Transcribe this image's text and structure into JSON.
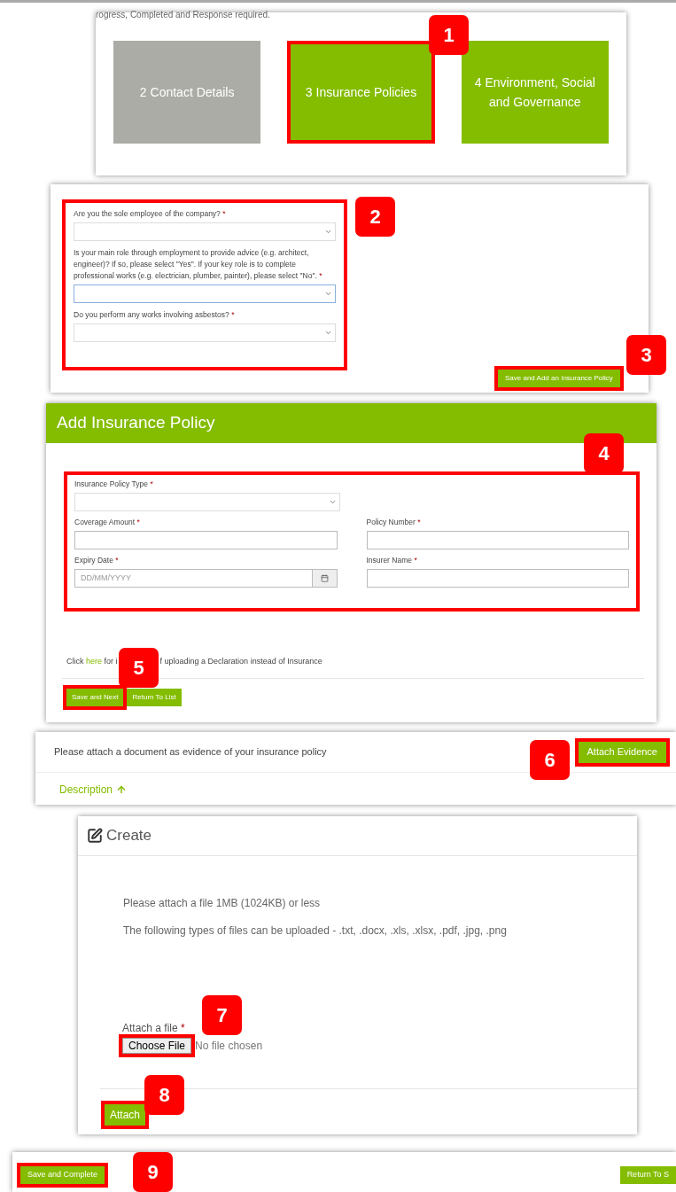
{
  "progress_panel": {
    "note": "rogress, Completed and Response required.",
    "callout": "1",
    "steps": [
      {
        "label": "2 Contact Details",
        "color": "#acaca6",
        "selected": false
      },
      {
        "label": "3 Insurance Policies",
        "color": "#84bc00",
        "selected": true
      },
      {
        "label": "4 Environment, Social and Governance",
        "color": "#84bc00",
        "selected": false
      }
    ]
  },
  "questions_panel": {
    "callout": "2",
    "highlighted": true,
    "questions": [
      {
        "label": "Are you the sole employee of the company?",
        "asterisk": "*",
        "focused": false
      },
      {
        "label": "Is your main role through employment to provide advice (e.g. architect, engineer)? If so, please select \"Yes\". If your key role is to complete professional works (e.g. electrician, plumber, painter), please select \"No\".",
        "asterisk": "*",
        "focused": true
      },
      {
        "label": "Do you perform any works involving asbestos?",
        "asterisk": "*",
        "focused": false
      }
    ],
    "save_button": {
      "label": "Save and Add an Insurance Policy",
      "highlighted": true,
      "callout": "3"
    }
  },
  "policy_form": {
    "title": "Add Insurance Policy",
    "callout": "4",
    "highlighted": true,
    "fields": [
      {
        "kind": "select",
        "label": "Insurance Policy Type",
        "asterisk": "*"
      },
      {
        "kind": "text",
        "label": "Coverage Amount",
        "asterisk": "*"
      },
      {
        "kind": "text",
        "label": "Policy Number",
        "asterisk": "*"
      },
      {
        "kind": "date",
        "label": "Expiry Date",
        "asterisk": "*",
        "placeholder": "DD/MM/YYYY"
      },
      {
        "kind": "text",
        "label": "Insurer Name",
        "asterisk": "*"
      }
    ],
    "note_start": "Click",
    "note_link": "here",
    "note_middle": "for i",
    "note_end": "f uploading a Declaration instead of Insurance",
    "buttons_callout": "5",
    "buttons": [
      {
        "label": "Save and Next",
        "highlighted": true
      },
      {
        "label": "Return To List",
        "highlighted": false
      }
    ]
  },
  "evidence_panel": {
    "text": "Please attach a document as evidence of your insurance policy",
    "button": {
      "label": "Attach Evidence",
      "highlighted": true
    },
    "callout": "6",
    "sort_column": "Description"
  },
  "create_dialog": {
    "title": "Create",
    "lines": [
      "Please attach a file 1MB (1024KB) or less",
      "The following types of files can be uploaded - .txt, .docx, .xls, .xlsx, .pdf, .jpg, .png"
    ],
    "file_label": "Attach a file",
    "asterisk": "*",
    "choose_button": {
      "label": "Choose File",
      "highlighted": true
    },
    "file_status": "No file chosen",
    "file_callout": "7",
    "attach_button": {
      "label": "Attach",
      "highlighted": true
    },
    "attach_callout": "8"
  },
  "footer": {
    "buttons": [
      {
        "label": "Save and Complete",
        "highlighted": true
      },
      {
        "label": "Return To S",
        "highlighted": false
      }
    ],
    "callout": "9"
  }
}
